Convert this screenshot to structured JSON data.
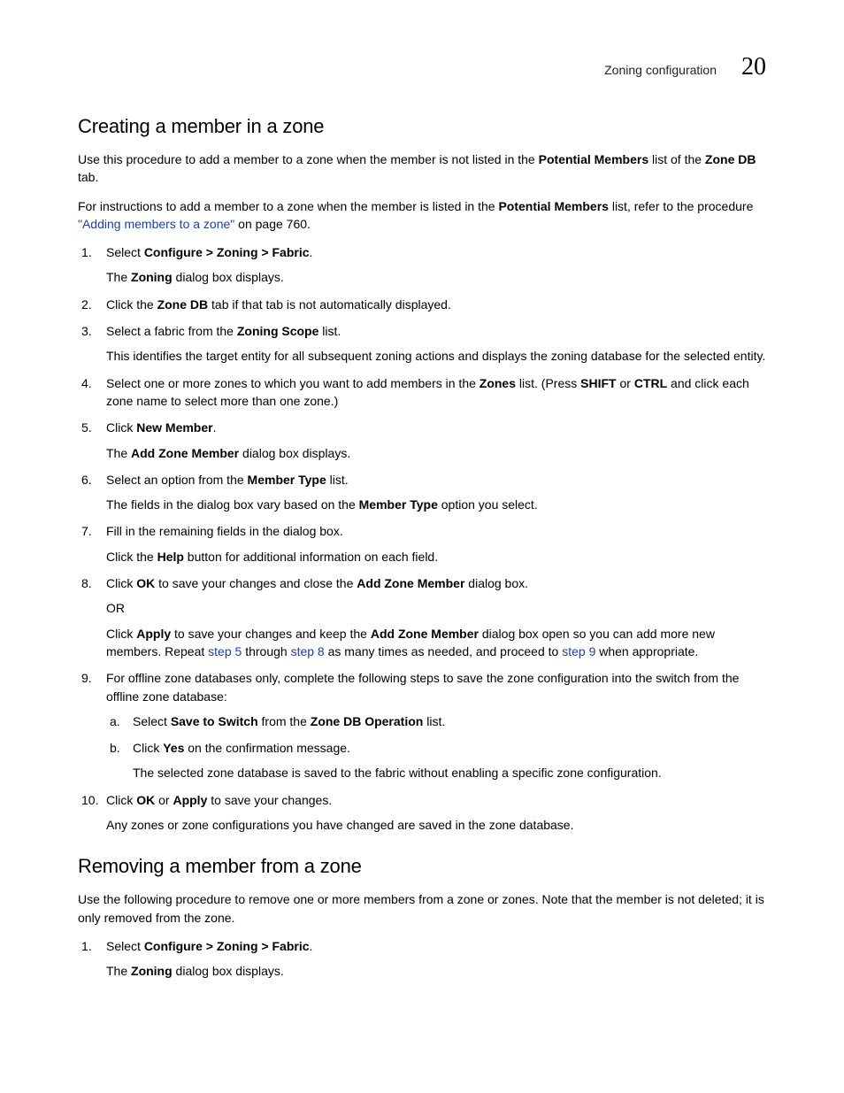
{
  "header": {
    "section_label": "Zoning configuration",
    "chapter_number": "20"
  },
  "section_creating": {
    "title": "Creating a member in a zone",
    "intro1_pre": "Use this procedure to add a member to a zone when the member is not listed in the ",
    "intro1_b1": "Potential Members",
    "intro1_mid": " list of the ",
    "intro1_b2": "Zone DB",
    "intro1_post": " tab.",
    "intro2_pre": "For instructions to add a member to a zone when the member is listed in the ",
    "intro2_b1": "Potential Members",
    "intro2_mid": " list, refer to the procedure ",
    "intro2_link": "\"Adding members to a zone\"",
    "intro2_post": " on page 760."
  },
  "steps_creating": {
    "s1_pre": "Select ",
    "s1_b": "Configure > Zoning > Fabric",
    "s1_post": ".",
    "s1_sub_pre": "The ",
    "s1_sub_b": "Zoning",
    "s1_sub_post": " dialog box displays.",
    "s2_pre": "Click the ",
    "s2_b": "Zone DB",
    "s2_post": " tab if that tab is not automatically displayed.",
    "s3_pre": "Select a fabric from the ",
    "s3_b": "Zoning Scope",
    "s3_post": " list.",
    "s3_sub": "This identifies the target entity for all subsequent zoning actions and displays the zoning database for the selected entity.",
    "s4_pre": "Select one or more zones to which you want to add members in the ",
    "s4_b1": "Zones",
    "s4_mid1": " list. (Press ",
    "s4_b2": "SHIFT",
    "s4_mid2": " or ",
    "s4_b3": "CTRL",
    "s4_post": " and click each zone name to select more than one zone.)",
    "s5_pre": "Click ",
    "s5_b": "New Member",
    "s5_post": ".",
    "s5_sub_pre": "The ",
    "s5_sub_b": "Add Zone Member",
    "s5_sub_post": " dialog box displays.",
    "s6_pre": "Select an option from the ",
    "s6_b": "Member Type",
    "s6_post": " list.",
    "s6_sub_pre": "The fields in the dialog box vary based on the ",
    "s6_sub_b": "Member Type",
    "s6_sub_post": " option you select.",
    "s7": "Fill in the remaining fields in the dialog box.",
    "s7_sub_pre": "Click the ",
    "s7_sub_b": "Help",
    "s7_sub_post": " button for additional information on each field.",
    "s8_pre": "Click ",
    "s8_b1": "OK",
    "s8_mid": " to save your changes and close the ",
    "s8_b2": "Add Zone Member",
    "s8_post": " dialog box.",
    "s8_or": "OR",
    "s8_alt_pre": "Click ",
    "s8_alt_b1": "Apply",
    "s8_alt_mid1": " to save your changes and keep the ",
    "s8_alt_b2": "Add Zone Member",
    "s8_alt_mid2": " dialog box open so you can add more new members. Repeat ",
    "s8_alt_link1": "step 5",
    "s8_alt_mid3": " through ",
    "s8_alt_link2": "step 8",
    "s8_alt_mid4": " as many times as needed, and proceed to ",
    "s8_alt_link3": "step 9",
    "s8_alt_post": " when appropriate.",
    "s9": "For offline zone databases only, complete the following steps to save the zone configuration into the switch from the offline zone database:",
    "s9a_pre": "Select ",
    "s9a_b1": "Save to Switch",
    "s9a_mid": " from the ",
    "s9a_b2": "Zone DB Operation",
    "s9a_post": " list.",
    "s9b_pre": "Click ",
    "s9b_b": "Yes",
    "s9b_post": " on the confirmation message.",
    "s9b_sub": "The selected zone database is saved to the fabric without enabling a specific zone configuration.",
    "s10_pre": "Click ",
    "s10_b1": "OK",
    "s10_mid": " or ",
    "s10_b2": "Apply",
    "s10_post": " to save your changes.",
    "s10_sub": "Any zones or zone configurations you have changed are saved in the zone database."
  },
  "section_removing": {
    "title": "Removing a member from a zone",
    "intro": "Use the following procedure to remove one or more members from a zone or zones. Note that the member is not deleted; it is only removed from the zone."
  },
  "steps_removing": {
    "s1_pre": "Select ",
    "s1_b": "Configure > Zoning > Fabric",
    "s1_post": ".",
    "s1_sub_pre": "The ",
    "s1_sub_b": "Zoning",
    "s1_sub_post": " dialog box displays."
  }
}
